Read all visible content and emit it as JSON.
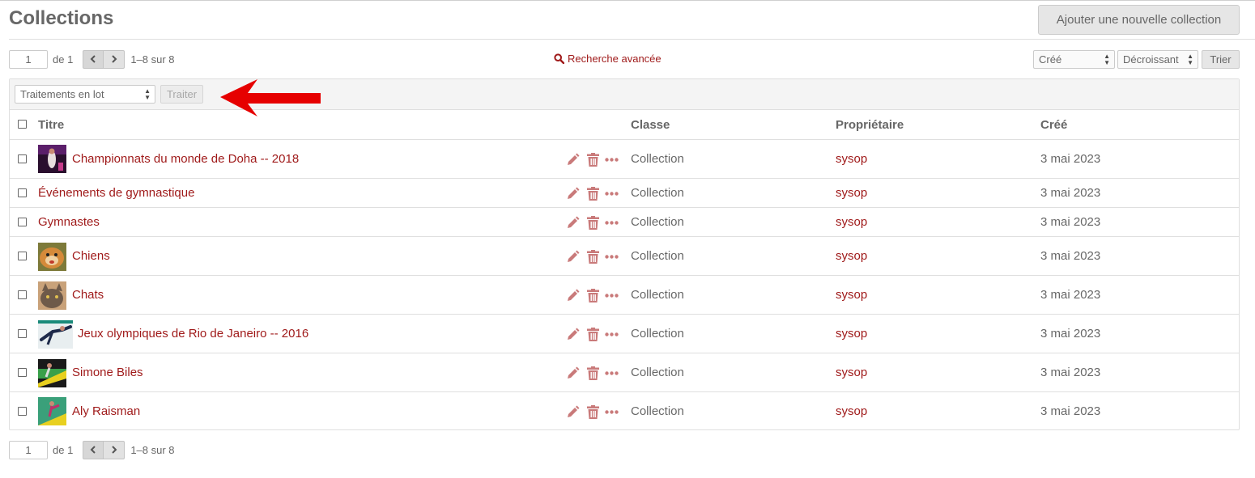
{
  "page": {
    "title": "Collections",
    "add_button": "Ajouter une nouvelle collection"
  },
  "pagination": {
    "current_page": "1",
    "of_label": "de 1",
    "range_label": "1–8 sur 8"
  },
  "search": {
    "advanced_label": "Recherche avancée"
  },
  "sort": {
    "by": "Créé",
    "order": "Décroissant",
    "button": "Trier"
  },
  "batch": {
    "select_label": "Traitements en lot",
    "button": "Traiter"
  },
  "table": {
    "headers": {
      "title": "Titre",
      "class": "Classe",
      "owner": "Propriétaire",
      "created": "Créé"
    },
    "rows": [
      {
        "title": "Championnats du monde de Doha -- 2018",
        "class": "Collection",
        "owner": "sysop",
        "created": "3 mai 2023"
      },
      {
        "title": "Événements de gymnastique",
        "class": "Collection",
        "owner": "sysop",
        "created": "3 mai 2023"
      },
      {
        "title": "Gymnastes",
        "class": "Collection",
        "owner": "sysop",
        "created": "3 mai 2023"
      },
      {
        "title": "Chiens",
        "class": "Collection",
        "owner": "sysop",
        "created": "3 mai 2023"
      },
      {
        "title": "Chats",
        "class": "Collection",
        "owner": "sysop",
        "created": "3 mai 2023"
      },
      {
        "title": "Jeux olympiques de Rio de Janeiro -- 2016",
        "class": "Collection",
        "owner": "sysop",
        "created": "3 mai 2023"
      },
      {
        "title": "Simone Biles",
        "class": "Collection",
        "owner": "sysop",
        "created": "3 mai 2023"
      },
      {
        "title": "Aly Raisman",
        "class": "Collection",
        "owner": "sysop",
        "created": "3 mai 2023"
      }
    ]
  },
  "colors": {
    "link": "#9f1919",
    "text": "#676767",
    "icon": "#c97a7a",
    "annotation_arrow": "#e60000"
  }
}
